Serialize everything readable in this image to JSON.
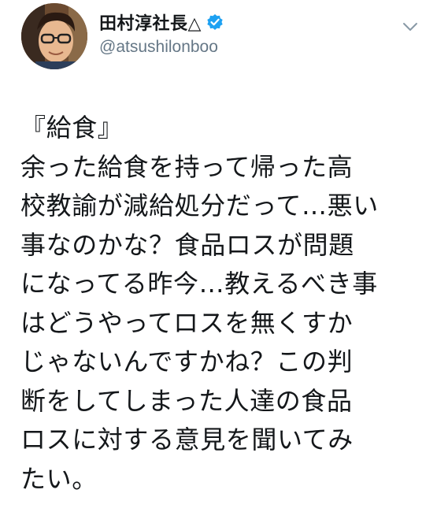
{
  "author": {
    "display_name": "田村淳社長△",
    "handle": "@atsushilonboo",
    "verified": true,
    "verified_color": "#1da1f2",
    "avatar_icon": "profile-photo"
  },
  "menu": {
    "icon": "chevron-down-icon"
  },
  "tweet": {
    "lines": [
      "『給食』",
      "余った給食を持って帰った高",
      "校教諭が減給処分だって…悪い",
      "事なのかな？食品ロスが問題",
      "になってる昨今…教えるべき事",
      "はどうやってロスを無くすか",
      "じゃないんですかね？この判",
      "断をしてしまった人達の食品",
      "ロスに対する意見を聞いてみ",
      "たい。"
    ]
  },
  "colors": {
    "text": "#14171a",
    "secondary": "#657786",
    "background": "#ffffff"
  }
}
